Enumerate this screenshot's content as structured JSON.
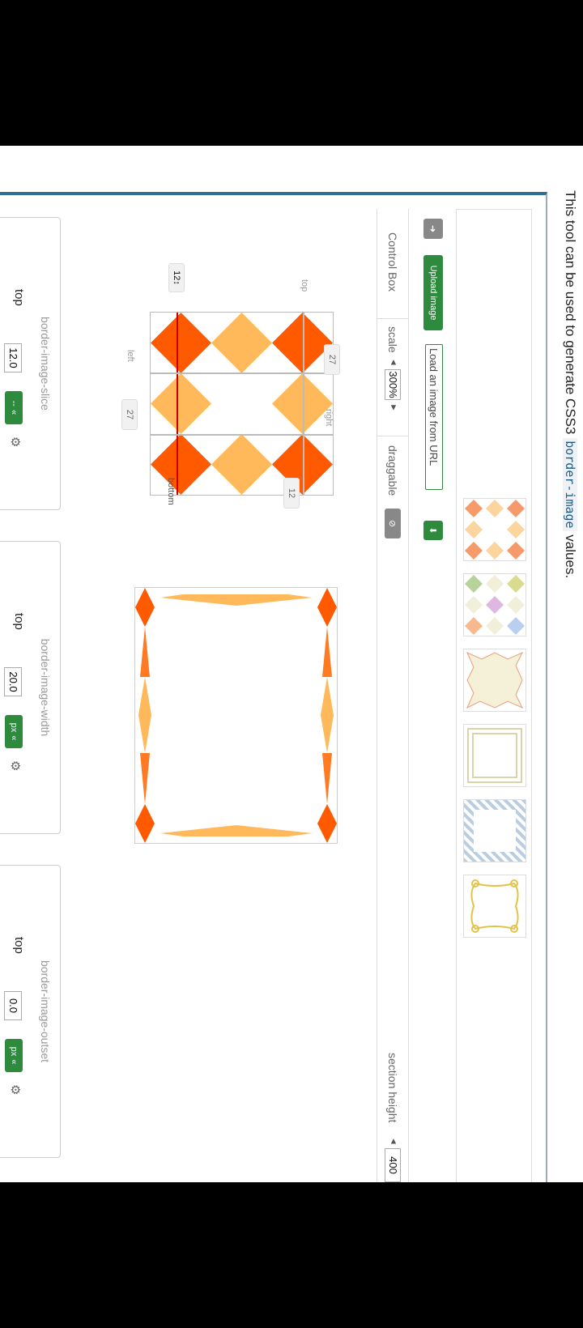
{
  "intro": {
    "before": "This tool can be used to generate CSS3 ",
    "code": "border-image",
    "after": " values."
  },
  "thumbnails": [
    {
      "name": "orange-diamonds"
    },
    {
      "name": "pastel-diamonds"
    },
    {
      "name": "cream-star"
    },
    {
      "name": "double-frame"
    },
    {
      "name": "blue-stripes"
    },
    {
      "name": "gold-ornate-frame"
    }
  ],
  "toolbar": {
    "upload_label": "Upload image",
    "url_placeholder": "Load an image from URL"
  },
  "control": {
    "title": "Control Box",
    "scale_label": "scale",
    "scale_value": "300%",
    "draggable_label": "draggable",
    "section_height_label": "section height",
    "section_height_value": "400"
  },
  "slice_editor": {
    "top_label": "top",
    "right_label": "right",
    "bottom_label": "bottom",
    "left_label": "left",
    "top_value": "12",
    "right_value": "27",
    "bottom_value": "12",
    "left_value": "27"
  },
  "panels": [
    {
      "title": "border-image-slice",
      "side": "top",
      "value": "12.0",
      "unit": "--"
    },
    {
      "title": "border-image-width",
      "side": "top",
      "value": "20.0",
      "unit": "px"
    },
    {
      "title": "border-image-outset",
      "side": "top",
      "value": "0.0",
      "unit": "px"
    }
  ],
  "colors": {
    "accent": "#2e8b3e",
    "orange": "#ff5a00",
    "light_orange": "#ffb95a",
    "border_blue": "#2f6f94"
  }
}
